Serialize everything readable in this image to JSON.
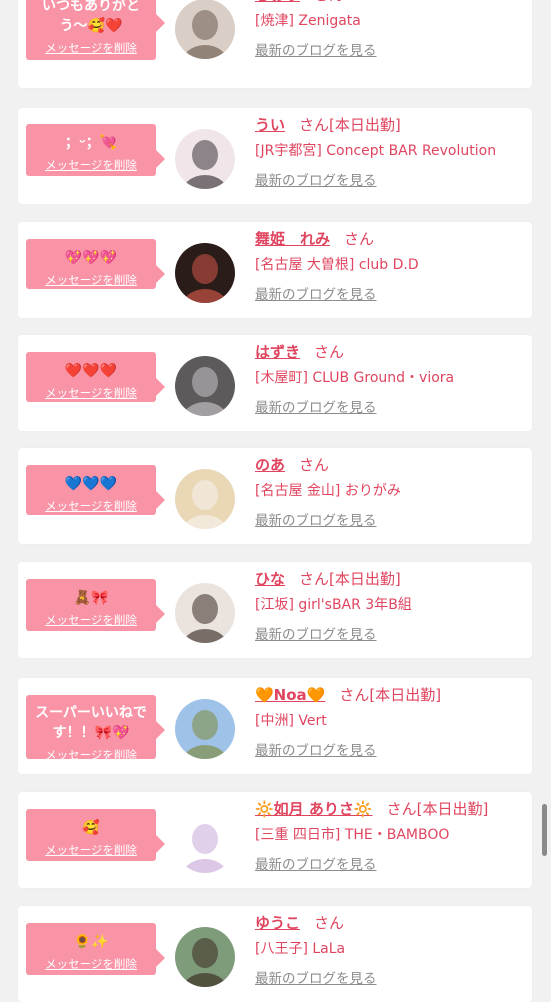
{
  "delete_label": "メッセージを削除",
  "honorific": "さん",
  "blog_label": "最新のブログを見る",
  "entries": [
    {
      "message": "いつもありがとう〜🥰❤️",
      "name": "しおり",
      "status": "",
      "shop": "[焼津] Zenigata",
      "avatar_colors": [
        "#d9cfc7",
        "#6b5a50"
      ]
    },
    {
      "message": "；ᵕ；💘",
      "name": "うい",
      "status": "[本日出勤]",
      "shop": "[JR宇都宮] Concept BAR Revolution",
      "avatar_colors": [
        "#f0e6ea",
        "#3a3338"
      ]
    },
    {
      "message": "💖💖💖",
      "name": "舞姫　れみ",
      "status": "",
      "shop": "[名古屋 大曽根] club D.D",
      "avatar_colors": [
        "#2a1c18",
        "#d4584a"
      ]
    },
    {
      "message": "❤️❤️❤️",
      "name": "はずき",
      "status": "",
      "shop": "[木屋町] CLUB Ground・viora",
      "avatar_colors": [
        "#5d5a5c",
        "#c9c3c6"
      ]
    },
    {
      "message": "💙💙💙",
      "name": "のあ",
      "status": "",
      "shop": "[名古屋 金山] おりがみ",
      "avatar_colors": [
        "#e9d7b6",
        "#f7f3ee"
      ]
    },
    {
      "message": "🧸🎀",
      "name": "ひな",
      "status": "[本日出勤]",
      "shop": "[江坂] girl'sBAR 3年B組",
      "avatar_colors": [
        "#ebe4de",
        "#3b2c26"
      ]
    },
    {
      "message": "スーパーいいねです！！🎀💖",
      "name": "🧡Noa🧡",
      "status": "[本日出勤]",
      "shop": "[中洲] Vert",
      "avatar_colors": [
        "#9fc3e8",
        "#7e8b3c"
      ]
    },
    {
      "message": "🥰",
      "name": "🔆如月 ありさ🔆",
      "status": "[本日出勤]",
      "shop": "[三重 四日市] THE・BAMBOO",
      "avatar_colors": [
        "#ffffff",
        "#c9a9d8"
      ]
    },
    {
      "message": "🌻✨",
      "name": "ゆうこ",
      "status": "",
      "shop": "[八王子] LaLa",
      "avatar_colors": [
        "#7e9c7a",
        "#3b2a22"
      ]
    }
  ]
}
